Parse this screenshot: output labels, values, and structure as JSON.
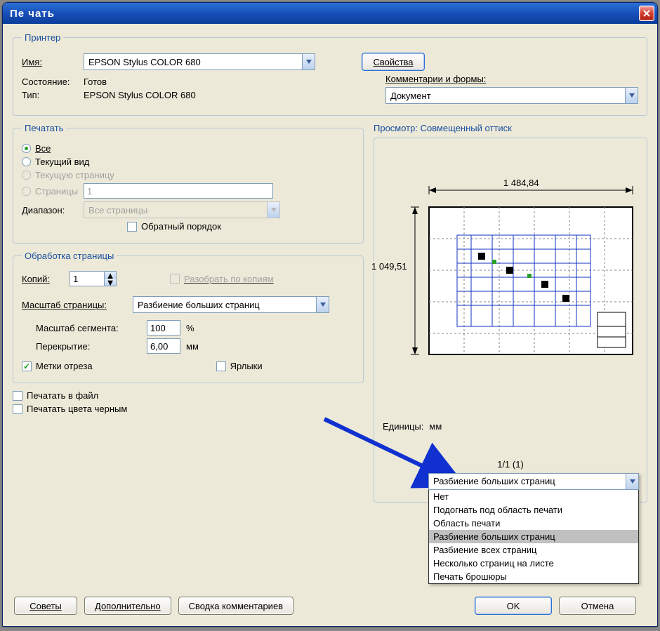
{
  "title": "Пе чать",
  "printer": {
    "legend": "Принтер",
    "name_label": "Имя:",
    "name_value": "EPSON Stylus COLOR 680",
    "properties_btn": "Свойства",
    "state_label": "Состояние:",
    "state_value": "Готов",
    "type_label": "Тип:",
    "type_value": "EPSON Stylus COLOR 680",
    "comments_label": "Комментарии и формы:",
    "comments_value": "Документ"
  },
  "range": {
    "legend": "Печатать",
    "all": "Все",
    "current_view": "Текущий вид",
    "current_page": "Текущую страницу",
    "pages": "Страницы",
    "pages_value": "1",
    "subrange_label": "Диапазон:",
    "subrange_value": "Все страницы",
    "reverse": "Обратный порядок"
  },
  "handling": {
    "legend": "Обработка страницы",
    "copies_label": "Копий:",
    "copies_value": "1",
    "collate": "Разобрать по копиям",
    "scale_label": "Масштаб страницы:",
    "scale_value": "Разбиение больших страниц",
    "tile_scale_label": "Масштаб сегмента:",
    "tile_scale_value": "100",
    "percent": "%",
    "overlap_label": "Перекрытие:",
    "overlap_value": "6,00",
    "mm": "мм",
    "cut_marks": "Метки отреза",
    "labels": "Ярлыки"
  },
  "print_to_file": "Печатать в файл",
  "black": "Печатать цвета черным",
  "preview": {
    "heading": "Просмотр: Совмещенный оттиск",
    "width": "1 484,84",
    "height": "1 049,51",
    "units_label": "Единицы:",
    "units_value": "мм",
    "counter": "1/1 (1)"
  },
  "buttons": {
    "tips": "Советы",
    "advanced": "Дополнительно",
    "summary": "Сводка комментариев",
    "ok": "OK",
    "cancel": "Отмена"
  },
  "scale_options": {
    "selected": "Разбиение больших страниц",
    "items": [
      "Нет",
      "Подогнать под область печати",
      "Область печати",
      "Разбиение больших страниц",
      "Разбиение всех страниц",
      "Несколько страниц на листе",
      "Печать брошюры"
    ]
  }
}
